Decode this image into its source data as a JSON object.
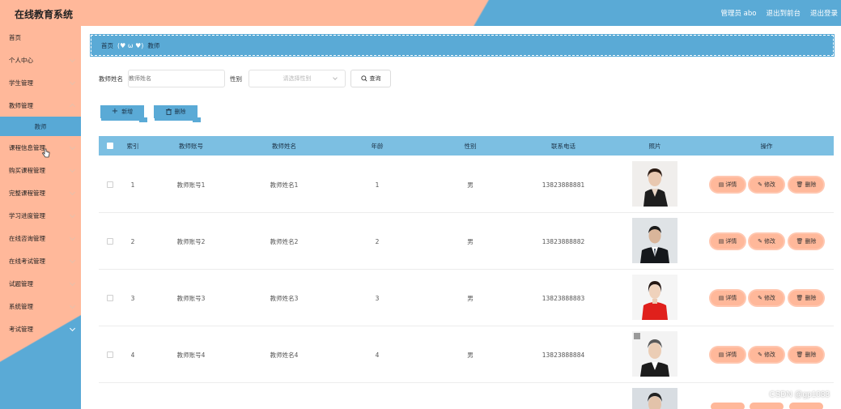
{
  "header": {
    "title": "在线教育系统",
    "admin_label": "管理员 abo",
    "exit_frontend": "退出到前台",
    "logout": "退出登录"
  },
  "sidebar": {
    "items": [
      {
        "label": "首页"
      },
      {
        "label": "个人中心"
      },
      {
        "label": "学生管理"
      },
      {
        "label": "教师管理"
      },
      {
        "label": "教师"
      },
      {
        "label": "课程信息管理"
      },
      {
        "label": "购买课程管理"
      },
      {
        "label": "完整课程管理"
      },
      {
        "label": "学习进度管理"
      },
      {
        "label": "在线咨询管理"
      },
      {
        "label": "在线考试管理"
      },
      {
        "label": "试题管理"
      },
      {
        "label": "系统管理"
      },
      {
        "label": "考试管理"
      }
    ]
  },
  "breadcrumb": {
    "home": "首页",
    "separator": "(♥ ω ♥)",
    "current": "教师"
  },
  "search": {
    "name_label": "教师姓名",
    "name_placeholder": "教师姓名",
    "gender_label": "性别",
    "gender_placeholder": "请选择性别",
    "query_label": "查询"
  },
  "actions": {
    "add_label": "新增",
    "delete_label": "删除"
  },
  "table": {
    "headers": [
      "索引",
      "教师账号",
      "教师姓名",
      "年龄",
      "性别",
      "联系电话",
      "照片",
      "操作"
    ],
    "rows": [
      {
        "index": "1",
        "account": "教师账号1",
        "name": "教师姓名1",
        "age": "1",
        "gender": "男",
        "phone": "13823888881"
      },
      {
        "index": "2",
        "account": "教师账号2",
        "name": "教师姓名2",
        "age": "2",
        "gender": "男",
        "phone": "13823888882"
      },
      {
        "index": "3",
        "account": "教师账号3",
        "name": "教师姓名3",
        "age": "3",
        "gender": "男",
        "phone": "13823888883"
      },
      {
        "index": "4",
        "account": "教师账号4",
        "name": "教师姓名4",
        "age": "4",
        "gender": "男",
        "phone": "13823888884"
      }
    ],
    "op_detail": "详情",
    "op_edit": "修改",
    "op_delete": "删除"
  },
  "watermark": "CSDN @gp1083",
  "colors": {
    "peach": "#ffb89a",
    "blue": "#5aaad6",
    "header_blue": "#7cbfe2"
  }
}
